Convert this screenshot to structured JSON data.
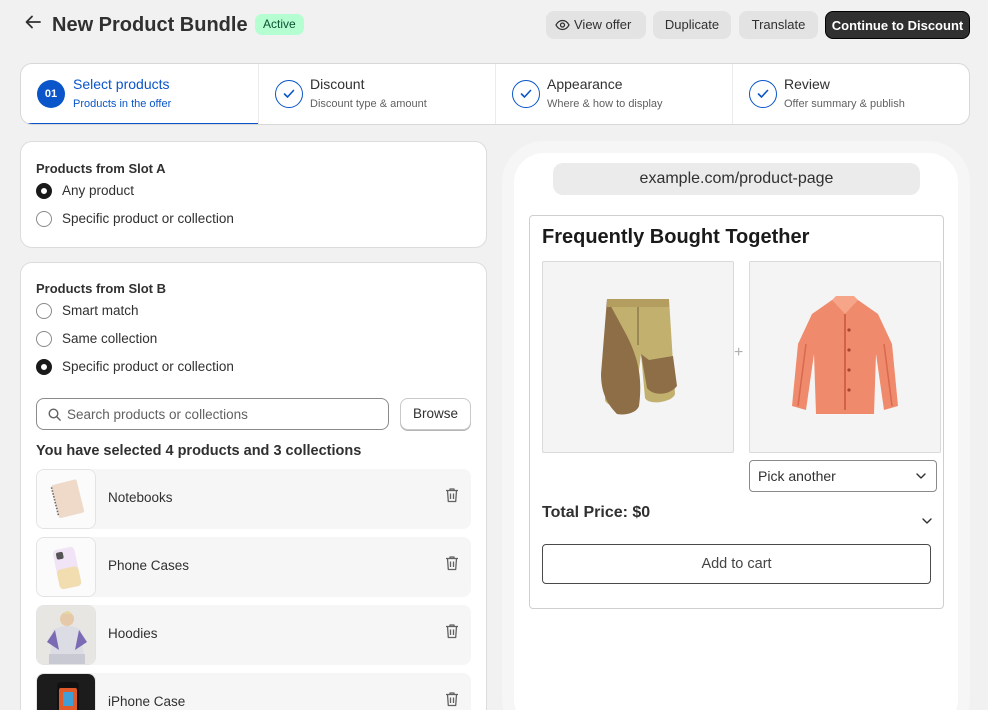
{
  "header": {
    "title": "New Product Bundle",
    "status": "Active",
    "view_offer": "View offer",
    "duplicate": "Duplicate",
    "translate": "Translate",
    "continue": "Continue to Discount"
  },
  "steps": [
    {
      "number": "01",
      "title": "Select products",
      "subtitle": "Products in the offer"
    },
    {
      "title": "Discount",
      "subtitle": "Discount type & amount"
    },
    {
      "title": "Appearance",
      "subtitle": "Where & how to display"
    },
    {
      "title": "Review",
      "subtitle": "Offer summary & publish"
    }
  ],
  "slot_a": {
    "title": "Products from Slot A",
    "options": [
      "Any product",
      "Specific product or collection"
    ],
    "selected": "Any product"
  },
  "slot_b": {
    "title": "Products from Slot B",
    "options": [
      "Smart match",
      "Same collection",
      "Specific product or collection"
    ],
    "selected": "Specific product or collection",
    "search_placeholder": "Search products or collections",
    "browse": "Browse",
    "selection_summary": "You have selected 4 products and 3 collections",
    "items": [
      {
        "name": "Notebooks"
      },
      {
        "name": "Phone Cases"
      },
      {
        "name": "Hoodies"
      },
      {
        "name": "iPhone Case"
      }
    ]
  },
  "preview": {
    "url": "example.com/product-page",
    "widget_title": "Frequently Bought Together",
    "plus": "+",
    "pick_another": "Pick another",
    "total": "Total Price: $0",
    "add_to_cart": "Add to cart"
  },
  "colors": {
    "accent": "#0a55c9",
    "badge_bg": "#b4fed2",
    "primary_button": "#303030"
  }
}
